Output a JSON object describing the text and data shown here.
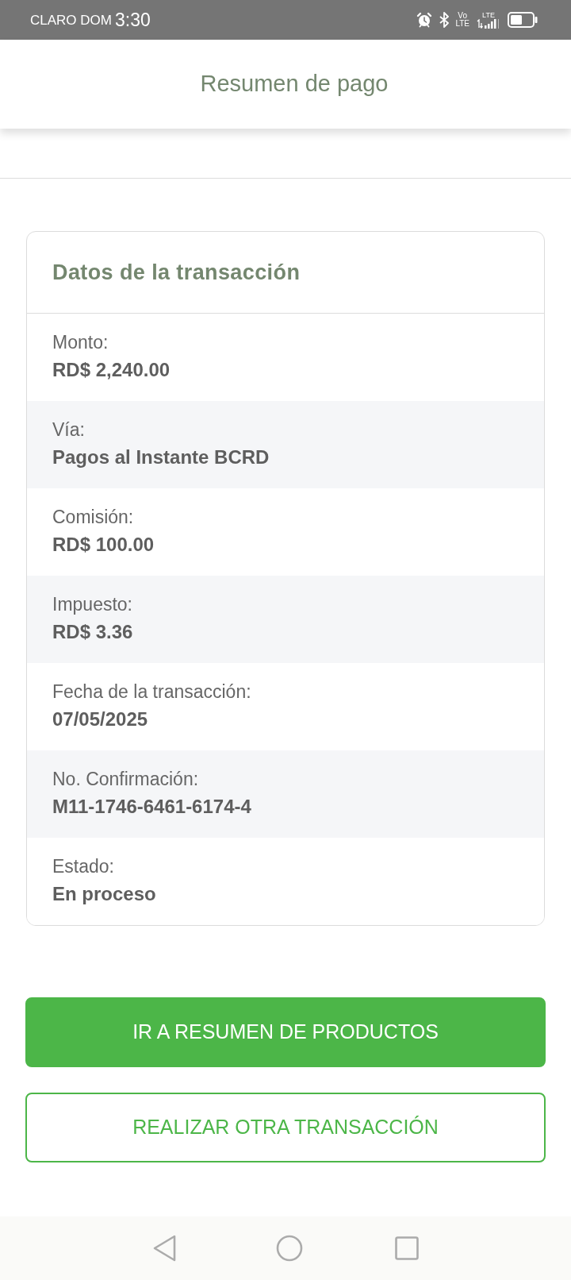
{
  "status_bar": {
    "carrier": "CLARO DOM",
    "time": "3:30",
    "volte": [
      "Vo",
      "LTE"
    ],
    "signal_label": "LTE"
  },
  "header": {
    "title": "Resumen de pago"
  },
  "card": {
    "title": "Datos de la transacción",
    "rows": [
      {
        "label": "Monto:",
        "value": "RD$ 2,240.00"
      },
      {
        "label": "Vía:",
        "value": "Pagos al Instante BCRD"
      },
      {
        "label": "Comisión:",
        "value": "RD$ 100.00"
      },
      {
        "label": "Impuesto:",
        "value": "RD$ 3.36"
      },
      {
        "label": "Fecha de la transacción:",
        "value": "07/05/2025"
      },
      {
        "label": "No. Confirmación:",
        "value": "M11-1746-6461-6174-4"
      },
      {
        "label": "Estado:",
        "value": "En proceso"
      }
    ]
  },
  "buttons": [
    {
      "label": "IR A RESUMEN DE PRODUCTOS",
      "kind": "primary"
    },
    {
      "label": "REALIZAR OTRA TRANSACCIÓN",
      "kind": "outline"
    }
  ]
}
